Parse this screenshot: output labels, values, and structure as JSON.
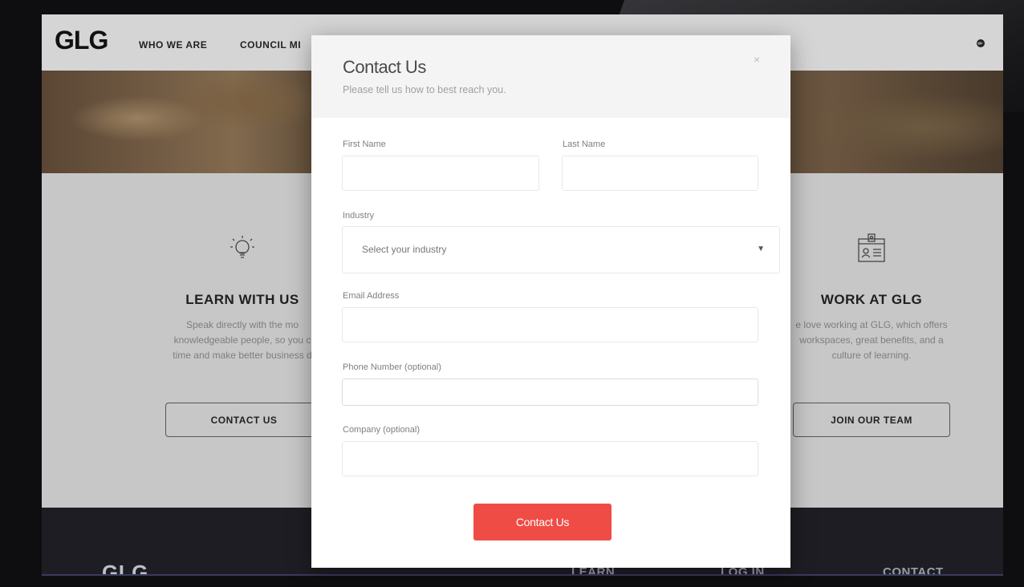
{
  "nav": {
    "logo": "GLG",
    "links": [
      "WHO WE ARE",
      "COUNCIL MI"
    ]
  },
  "left_column": {
    "heading": "LEARN WITH US",
    "text_lines": [
      "Speak directly with the mo",
      "knowledgeable people, so you c",
      "time and make better business d"
    ],
    "button": "CONTACT US"
  },
  "right_column": {
    "heading": "WORK AT GLG",
    "text_lines": [
      "e love working at GLG, which offers",
      "workspaces, great benefits, and a",
      "culture of learning."
    ],
    "button": "JOIN OUR TEAM"
  },
  "footer": {
    "logo": "GLG",
    "links": [
      "LEARN",
      "LOG IN",
      "CONTACT"
    ]
  },
  "modal": {
    "title": "Contact Us",
    "subtitle": "Please tell us how to best reach you.",
    "close": "×",
    "fields": {
      "first_name_label": "First Name",
      "last_name_label": "Last Name",
      "industry_label": "Industry",
      "industry_placeholder": "Select your industry",
      "email_label": "Email Address",
      "phone_label": "Phone Number (optional)",
      "company_label": "Company (optional)"
    },
    "submit": "Contact Us"
  },
  "colors": {
    "accent": "#ef4c45",
    "footer_bg": "#1d1d23",
    "page_bg": "#c7c7c7"
  },
  "icons": [
    "globe-icon",
    "lightbulb-icon",
    "id-badge-icon",
    "chevron-down-icon",
    "close-icon"
  ]
}
